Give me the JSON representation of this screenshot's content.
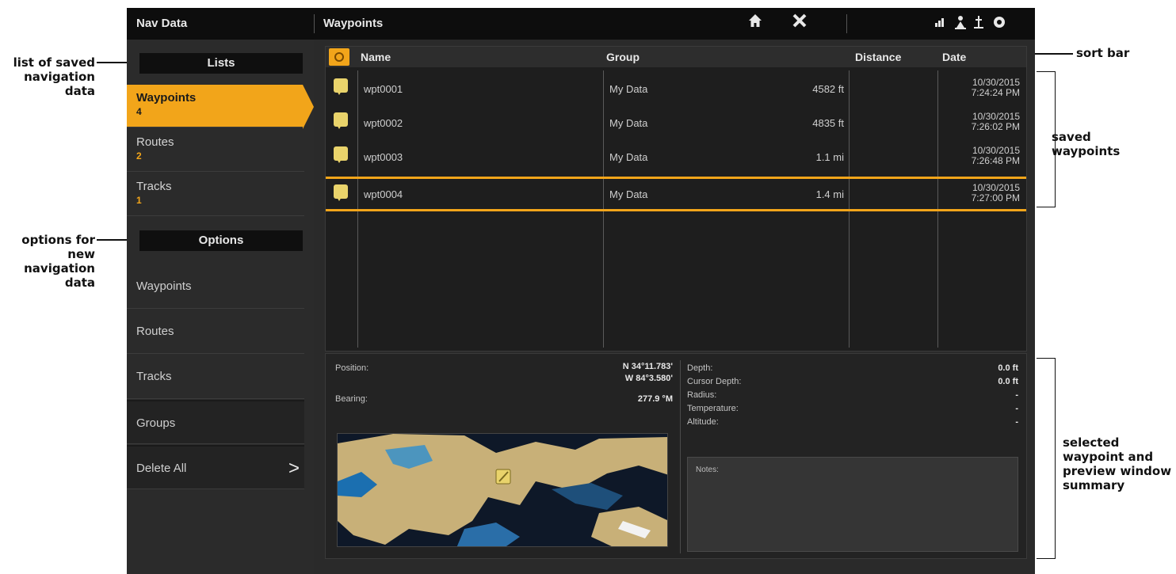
{
  "titlebar": {
    "left_title": "Nav Data",
    "center_title": "Waypoints",
    "home_icon": "home-icon",
    "close_icon": "close-x-icon",
    "status_icons": [
      "gps-signal-icon",
      "person-icon",
      "anchor-icon",
      "settings-gear-icon"
    ]
  },
  "sidebar": {
    "lists_header": "Lists",
    "lists": [
      {
        "label": "Waypoints",
        "count": "4"
      },
      {
        "label": "Routes",
        "count": "2"
      },
      {
        "label": "Tracks",
        "count": "1"
      }
    ],
    "options_header": "Options",
    "options": [
      {
        "label": "Waypoints"
      },
      {
        "label": "Routes"
      },
      {
        "label": "Tracks"
      },
      {
        "label": "Groups"
      },
      {
        "label": "Delete All",
        "chevron": ">"
      }
    ]
  },
  "table": {
    "columns": {
      "name": "Name",
      "group": "Group",
      "distance": "Distance",
      "date": "Date"
    },
    "rows": [
      {
        "name": "wpt0001",
        "group": "My Data",
        "distance": "4582 ft",
        "date": "10/30/2015",
        "time": "7:24:24 PM"
      },
      {
        "name": "wpt0002",
        "group": "My Data",
        "distance": "4835 ft",
        "date": "10/30/2015",
        "time": "7:26:02 PM"
      },
      {
        "name": "wpt0003",
        "group": "My Data",
        "distance": "1.1 mi",
        "date": "10/30/2015",
        "time": "7:26:48 PM"
      },
      {
        "name": "wpt0004",
        "group": "My Data",
        "distance": "1.4 mi",
        "date": "10/30/2015",
        "time": "7:27:00 PM",
        "selected": true
      }
    ]
  },
  "summary": {
    "position_label": "Position:",
    "position_lat": "N 34°11.783'",
    "position_lon": "W 84°3.580'",
    "bearing_label": "Bearing:",
    "bearing_value": "277.9 °M",
    "depth_label": "Depth:",
    "depth_value": "0.0 ft",
    "cursor_depth_label": "Cursor Depth:",
    "cursor_depth_value": "0.0 ft",
    "radius_label": "Radius:",
    "radius_value": "-",
    "temperature_label": "Temperature:",
    "temperature_value": "-",
    "altitude_label": "Altitude:",
    "altitude_value": "-",
    "notes_label": "Notes:"
  },
  "callouts": {
    "saved_lists": "list of saved navigation data",
    "options": "options for new navigation data",
    "sort_bar": "sort bar",
    "saved_waypoints": "saved waypoints",
    "summary": "selected waypoint and preview window summary"
  },
  "colors": {
    "accent": "#f2a51a",
    "background": "#2a2a2a",
    "titlebar": "#0d0d0d"
  }
}
